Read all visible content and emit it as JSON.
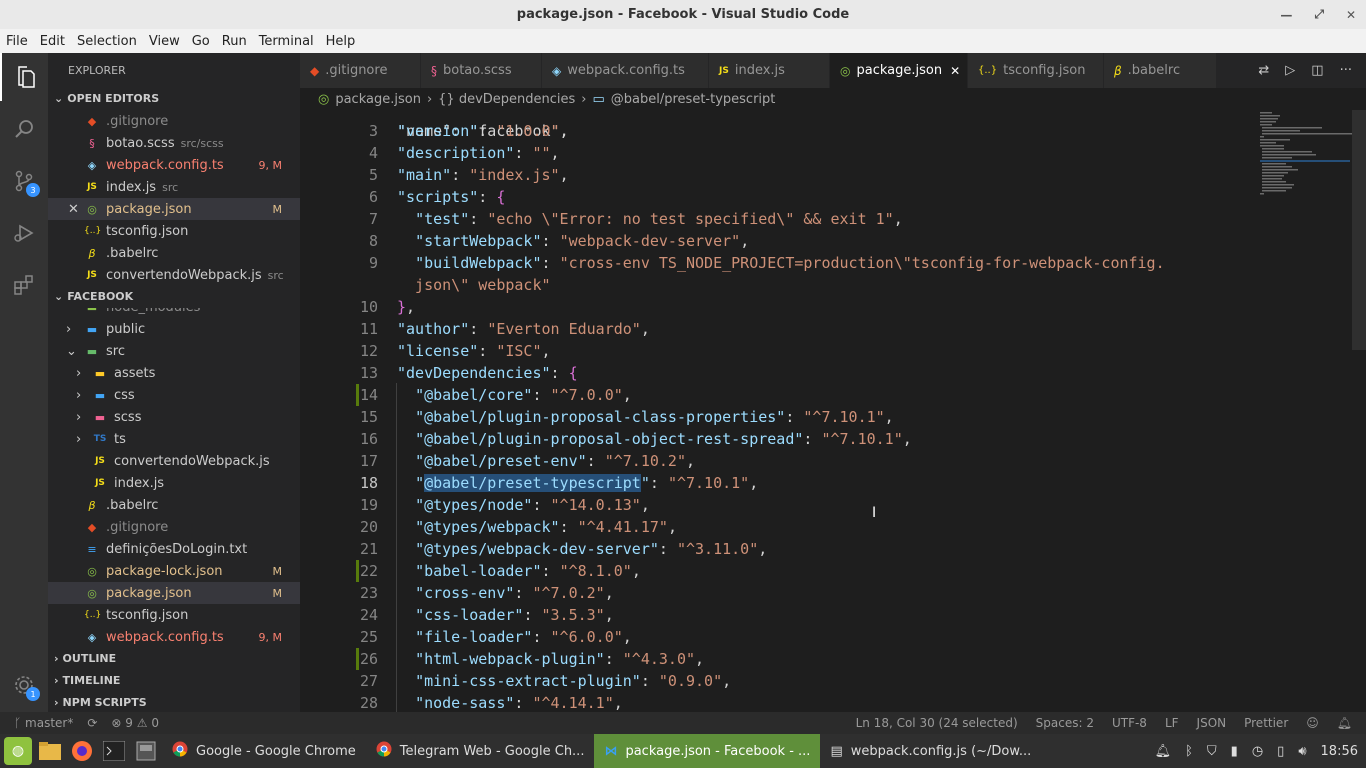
{
  "window": {
    "title": "package.json - Facebook - Visual Studio Code"
  },
  "menu": [
    "File",
    "Edit",
    "Selection",
    "View",
    "Go",
    "Run",
    "Terminal",
    "Help"
  ],
  "activity": {
    "scm_badge": "3",
    "accounts_badge": "1"
  },
  "sidebar": {
    "title": "EXPLORER",
    "open_editors": {
      "label": "OPEN EDITORS",
      "items": [
        {
          "name": ".gitignore",
          "desc": "",
          "status": "",
          "kind": "ign"
        },
        {
          "name": "botao.scss",
          "desc": "src/scss",
          "status": "",
          "kind": "normal"
        },
        {
          "name": "webpack.config.ts",
          "desc": "",
          "status": "9, M",
          "kind": "err"
        },
        {
          "name": "index.js",
          "desc": "src",
          "status": "",
          "kind": "normal"
        },
        {
          "name": "package.json",
          "desc": "",
          "status": "M",
          "kind": "mod"
        },
        {
          "name": "tsconfig.json",
          "desc": "",
          "status": "",
          "kind": "normal"
        },
        {
          "name": ".babelrc",
          "desc": "",
          "status": "",
          "kind": "normal"
        },
        {
          "name": "convertendoWebpack.js",
          "desc": "src",
          "status": "",
          "kind": "normal"
        }
      ]
    },
    "project": {
      "label": "FACEBOOK",
      "partial_item": "node_modules",
      "items": [
        {
          "name": "public",
          "status": "",
          "kind": "normal"
        },
        {
          "name": "src",
          "status": "",
          "kind": "normal"
        },
        {
          "name": "assets",
          "status": "",
          "kind": "normal"
        },
        {
          "name": "css",
          "status": "",
          "kind": "normal"
        },
        {
          "name": "scss",
          "status": "",
          "kind": "normal"
        },
        {
          "name": "ts",
          "status": "",
          "kind": "normal"
        },
        {
          "name": "convertendoWebpack.js",
          "status": "",
          "kind": "normal"
        },
        {
          "name": "index.js",
          "status": "",
          "kind": "normal"
        },
        {
          "name": ".babelrc",
          "status": "",
          "kind": "normal"
        },
        {
          "name": ".gitignore",
          "status": "",
          "kind": "ign"
        },
        {
          "name": "definiçõesDoLogin.txt",
          "status": "",
          "kind": "normal"
        },
        {
          "name": "package-lock.json",
          "status": "M",
          "kind": "mod"
        },
        {
          "name": "package.json",
          "status": "M",
          "kind": "mod"
        },
        {
          "name": "tsconfig.json",
          "status": "",
          "kind": "normal"
        },
        {
          "name": "webpack.config.ts",
          "status": "9, M",
          "kind": "err"
        }
      ]
    },
    "outline": "OUTLINE",
    "timeline": "TIMELINE",
    "npm_scripts": "NPM SCRIPTS"
  },
  "tabs": [
    {
      "label": ".gitignore",
      "icon": "◆"
    },
    {
      "label": "botao.scss",
      "icon": "§"
    },
    {
      "label": "webpack.config.ts",
      "icon": "◈"
    },
    {
      "label": "index.js",
      "icon": "JS"
    },
    {
      "label": "package.json",
      "icon": "◎",
      "close": "✕"
    },
    {
      "label": "tsconfig.json",
      "icon": "{..}"
    },
    {
      "label": ".babelrc",
      "icon": "β"
    }
  ],
  "breadcrumb": [
    "package.json",
    "{} devDependencies",
    "@babel/preset-typescript"
  ],
  "code": {
    "partial_top": "\"name\": \"facebook\",",
    "lines": [
      {
        "n": "3",
        "t": "\"version\": \"1.0.0\","
      },
      {
        "n": "4",
        "t": "\"description\": \"\","
      },
      {
        "n": "5",
        "t": "\"main\": \"index.js\","
      },
      {
        "n": "6",
        "t": "\"scripts\": {"
      },
      {
        "n": "7",
        "t": "  \"test\": \"echo \\\"Error: no test specified\\\" && exit 1\","
      },
      {
        "n": "8",
        "t": "  \"startWebpack\": \"webpack-dev-server\","
      },
      {
        "n": "9",
        "t": "  \"buildWebpack\": \"cross-env TS_NODE_PROJECT=production\\\"tsconfig-for-webpack-config."
      },
      {
        "n": "",
        "t": "  json\\\" webpack\""
      },
      {
        "n": "10",
        "t": "},"
      },
      {
        "n": "11",
        "t": "\"author\": \"Everton Eduardo\","
      },
      {
        "n": "12",
        "t": "\"license\": \"ISC\","
      },
      {
        "n": "13",
        "t": "\"devDependencies\": {"
      },
      {
        "n": "14",
        "t": "  \"@babel/core\": \"^7.0.0\","
      },
      {
        "n": "15",
        "t": "  \"@babel/plugin-proposal-class-properties\": \"^7.10.1\","
      },
      {
        "n": "16",
        "t": "  \"@babel/plugin-proposal-object-rest-spread\": \"^7.10.1\","
      },
      {
        "n": "17",
        "t": "  \"@babel/preset-env\": \"^7.10.2\","
      },
      {
        "n": "18",
        "t": "  \"@babel/preset-typescript\": \"^7.10.1\","
      },
      {
        "n": "19",
        "t": "  \"@types/node\": \"^14.0.13\","
      },
      {
        "n": "20",
        "t": "  \"@types/webpack\": \"^4.41.17\","
      },
      {
        "n": "21",
        "t": "  \"@types/webpack-dev-server\": \"^3.11.0\","
      },
      {
        "n": "22",
        "t": "  \"babel-loader\": \"^8.1.0\","
      },
      {
        "n": "23",
        "t": "  \"cross-env\": \"^7.0.2\","
      },
      {
        "n": "24",
        "t": "  \"css-loader\": \"3.5.3\","
      },
      {
        "n": "25",
        "t": "  \"file-loader\": \"^6.0.0\","
      },
      {
        "n": "26",
        "t": "  \"html-webpack-plugin\": \"^4.3.0\","
      },
      {
        "n": "27",
        "t": "  \"mini-css-extract-plugin\": \"0.9.0\","
      },
      {
        "n": "28",
        "t": "  \"node-sass\": \"^4.14.1\","
      }
    ]
  },
  "status": {
    "branch": "master*",
    "problems": "⊗ 9 ⚠ 0",
    "position": "Ln 18, Col 30 (24 selected)",
    "spaces": "Spaces: 2",
    "encoding": "UTF-8",
    "eol": "LF",
    "language": "JSON",
    "formatter": "Prettier"
  },
  "taskbar": {
    "windows": [
      {
        "label": "Google - Google Chrome",
        "active": false
      },
      {
        "label": "Telegram Web - Google Ch...",
        "active": false
      },
      {
        "label": "package.json - Facebook - ...",
        "active": true
      },
      {
        "label": "webpack.config.js (~/Dow...",
        "active": false
      }
    ],
    "clock": "18:56"
  },
  "colors": {
    "accent": "#007acc",
    "taskbar_active": "#5f8f3a",
    "modified": "#e2c08d",
    "error": "#f88070"
  }
}
